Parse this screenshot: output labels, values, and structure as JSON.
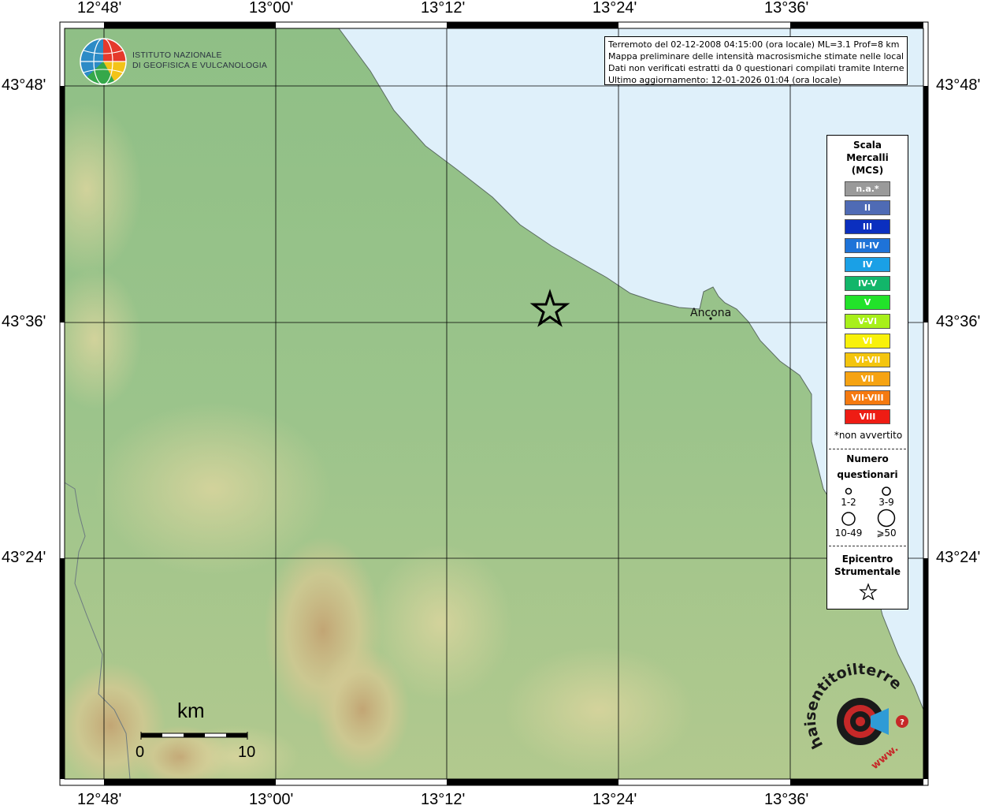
{
  "map": {
    "lon_labels": [
      "12°48'",
      "13°00'",
      "13°12'",
      "13°24'",
      "13°36'"
    ],
    "lat_labels": [
      "43°48'",
      "43°36'",
      "43°24'"
    ],
    "city": "Ancona",
    "colors": {
      "sea": "#dff0fa",
      "land": "#9bc28a",
      "frame": "#000000"
    }
  },
  "logo": {
    "line1": "ISTITUTO NAZIONALE",
    "line2": "DI GEOFISICA E VULCANOLOGIA"
  },
  "info": {
    "line1": "Terremoto del 02-12-2008 04:15:00 (ora locale) ML=3.1 Prof=8 km",
    "line2": "Mappa preliminare delle intensità macrosismiche stimate nelle località",
    "line3": "Dati non verificati estratti da 0 questionari compilati tramite Internet.",
    "line4": "Ultimo aggiornamento: 12-01-2026 01:04 (ora locale)"
  },
  "legend": {
    "title1": "Scala",
    "title2": "Mercalli",
    "title3": "(MCS)",
    "scale": [
      {
        "label": "n.a.*",
        "color": "#9a9a9a"
      },
      {
        "label": "II",
        "color": "#4f6bb5"
      },
      {
        "label": "III",
        "color": "#0b2fbf"
      },
      {
        "label": "III-IV",
        "color": "#1e73d8"
      },
      {
        "label": "IV",
        "color": "#1aa0e6"
      },
      {
        "label": "IV-V",
        "color": "#12b66a"
      },
      {
        "label": "V",
        "color": "#22e22a"
      },
      {
        "label": "V-VI",
        "color": "#a8f01a"
      },
      {
        "label": "VI",
        "color": "#f8f10a"
      },
      {
        "label": "VI-VII",
        "color": "#f4c50e"
      },
      {
        "label": "VII",
        "color": "#f6a312"
      },
      {
        "label": "VII-VIII",
        "color": "#f57a10"
      },
      {
        "label": "VIII",
        "color": "#ee1c14"
      }
    ],
    "note": "*non avvertito",
    "count_title1": "Numero",
    "count_title2": "questionari",
    "count_labels": [
      "1-2",
      "3-9",
      "10-49",
      "⩾50"
    ],
    "epi_title1": "Epicentro",
    "epi_title2": "Strumentale"
  },
  "scale_bar": {
    "unit": "km",
    "start": "0",
    "end": "10"
  },
  "watermark": {
    "site": "haisentitoilterremoto.it",
    "www": "www."
  }
}
